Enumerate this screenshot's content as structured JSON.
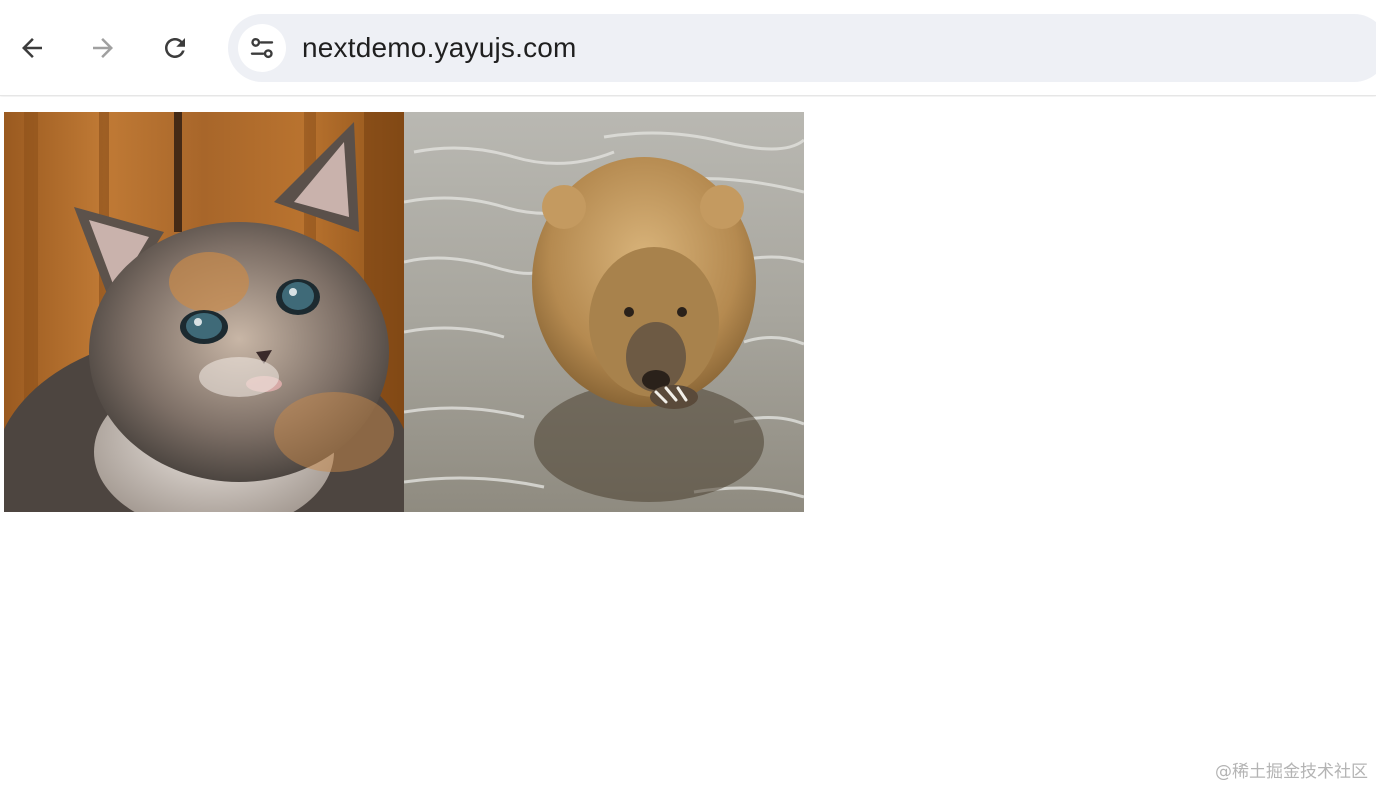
{
  "toolbar": {
    "back_icon": "arrow-left-icon",
    "forward_icon": "arrow-right-icon",
    "reload_icon": "reload-icon",
    "site_info_icon": "tune-icon"
  },
  "address_bar": {
    "url": "nextdemo.yayujs.com"
  },
  "page": {
    "images": [
      {
        "subject": "kitten"
      },
      {
        "subject": "bear"
      }
    ]
  },
  "watermark": {
    "text": "@稀土掘金技术社区"
  },
  "colors": {
    "omnibox_bg": "#eef0f5",
    "icon_active": "#3c3c3c",
    "icon_disabled": "#a0a0a0"
  }
}
